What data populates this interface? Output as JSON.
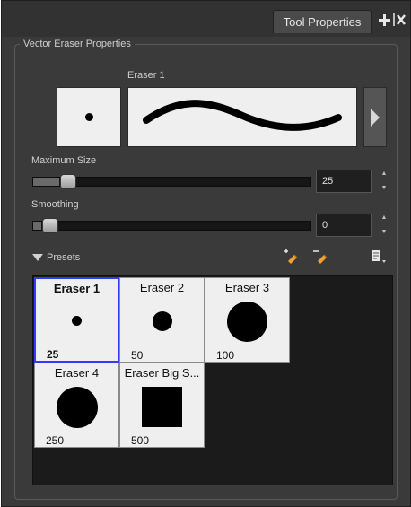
{
  "window": {
    "tab_label": "Tool Properties",
    "add_icon": "plus-icon",
    "close_icon": "close-icon"
  },
  "properties": {
    "group_title": "Vector Eraser Properties",
    "eraser_name": "Eraser 1"
  },
  "max_size": {
    "label": "Maximum Size",
    "value": "25",
    "level": 0.07
  },
  "smoothing": {
    "label": "Smoothing",
    "value": "0",
    "level": 0.0
  },
  "presets": {
    "label": "Presets",
    "items": [
      {
        "name": "Eraser 1",
        "size": "25",
        "selected": true
      },
      {
        "name": "Eraser 2",
        "size": "50",
        "selected": false
      },
      {
        "name": "Eraser 3",
        "size": "100",
        "selected": false
      },
      {
        "name": "Eraser 4",
        "size": "250",
        "selected": false
      },
      {
        "name": "Eraser Big S...",
        "size": "500",
        "selected": false
      }
    ]
  },
  "colors": {
    "panel_bg": "#3a3a3a",
    "selected_border": "#2f3cf0",
    "pencil_accent": "#f2a030"
  }
}
